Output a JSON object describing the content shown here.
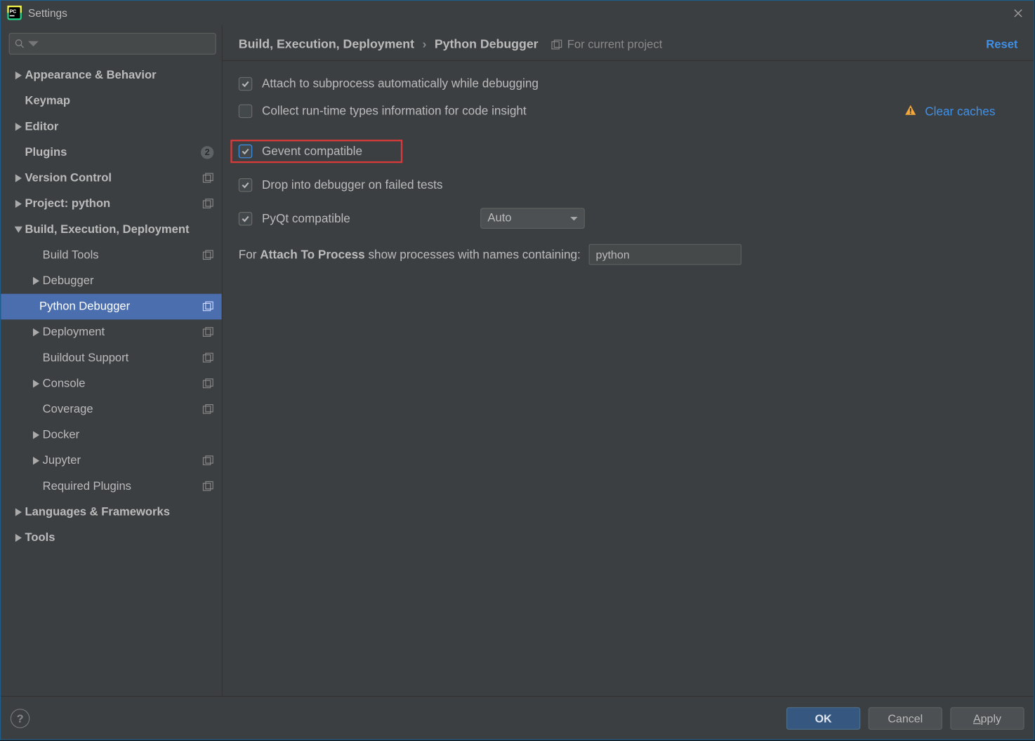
{
  "window": {
    "title": "Settings"
  },
  "sidebar": {
    "items": [
      {
        "label": "Appearance & Behavior"
      },
      {
        "label": "Keymap"
      },
      {
        "label": "Editor"
      },
      {
        "label": "Plugins",
        "badge": "2"
      },
      {
        "label": "Version Control"
      },
      {
        "label": "Project: python"
      },
      {
        "label": "Build, Execution, Deployment"
      },
      {
        "label": "Build Tools"
      },
      {
        "label": "Debugger"
      },
      {
        "label": "Python Debugger"
      },
      {
        "label": "Deployment"
      },
      {
        "label": "Buildout Support"
      },
      {
        "label": "Console"
      },
      {
        "label": "Coverage"
      },
      {
        "label": "Docker"
      },
      {
        "label": "Jupyter"
      },
      {
        "label": "Required Plugins"
      },
      {
        "label": "Languages & Frameworks"
      },
      {
        "label": "Tools"
      }
    ]
  },
  "header": {
    "crumb1": "Build, Execution, Deployment",
    "crumb2": "Python Debugger",
    "scope": "For current project",
    "reset": "Reset"
  },
  "options": {
    "attach_subprocess": "Attach to subprocess automatically while debugging",
    "collect_types": "Collect run-time types information for code insight",
    "gevent": "Gevent compatible",
    "drop_debugger": "Drop into debugger on failed tests",
    "pyqt": "PyQt compatible",
    "pyqt_mode": "Auto",
    "clear_caches": "Clear caches",
    "attach_prefix": "For ",
    "attach_bold": "Attach To Process",
    "attach_suffix": " show processes with names containing:",
    "attach_value": "python"
  },
  "footer": {
    "ok": "OK",
    "cancel": "Cancel",
    "apply": "Apply"
  }
}
